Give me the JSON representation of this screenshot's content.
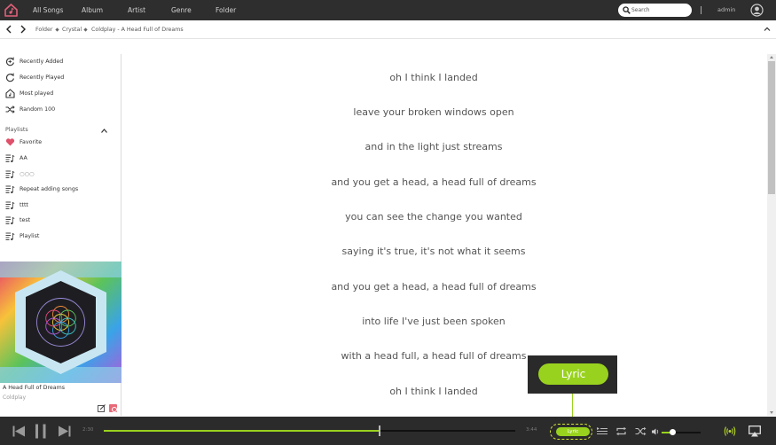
{
  "app": {
    "accent": "#99d21e",
    "topbar_color": "#2e2e2e",
    "player_color": "#2b2b2b"
  },
  "nav": {
    "tabs": [
      {
        "label": "All Songs"
      },
      {
        "label": "Album"
      },
      {
        "label": "Artist"
      },
      {
        "label": "Genre"
      },
      {
        "label": "Folder"
      }
    ],
    "search_placeholder": "Search",
    "user": "admin"
  },
  "breadcrumb": [
    "Folder",
    "Crystal",
    "Coldplay - A Head Full of Dreams"
  ],
  "sidebar": {
    "library": [
      {
        "label": "Recently Added",
        "icon": "recently-added-icon"
      },
      {
        "label": "Recently Played",
        "icon": "recently-played-icon"
      },
      {
        "label": "Most played",
        "icon": "most-played-icon"
      },
      {
        "label": "Random 100",
        "icon": "shuffle-icon"
      }
    ],
    "playlists_header": "Playlists",
    "playlists": [
      {
        "label": "Favorite",
        "icon": "heart-icon"
      },
      {
        "label": "AA",
        "icon": "playlist-icon"
      },
      {
        "label": "○○○",
        "icon": "playlist-icon"
      },
      {
        "label": "Repeat adding songs",
        "icon": "playlist-icon"
      },
      {
        "label": "tttt",
        "icon": "playlist-icon"
      },
      {
        "label": "test",
        "icon": "playlist-icon"
      },
      {
        "label": "Playlist",
        "icon": "playlist-icon"
      }
    ],
    "now_playing": {
      "title": "A Head Full of Dreams",
      "artist": "Coldplay"
    }
  },
  "lyrics": [
    "oh I think I landed",
    "leave your broken windows open",
    "and in the light just streams",
    "and you get a head, a head full of dreams",
    "you can see the change you wanted",
    "saying it's true, it's not what it seems",
    "and you get a head, a head full of dreams",
    "into life I've just been spoken",
    "with a head full, a head full of dreams",
    "oh I think I landed"
  ],
  "callout": {
    "label": "Lyric"
  },
  "player": {
    "elapsed": "2:30",
    "duration": "3:44",
    "progress_fraction": 0.67,
    "volume_fraction": 0.28,
    "lyric_button": "Lyric"
  }
}
